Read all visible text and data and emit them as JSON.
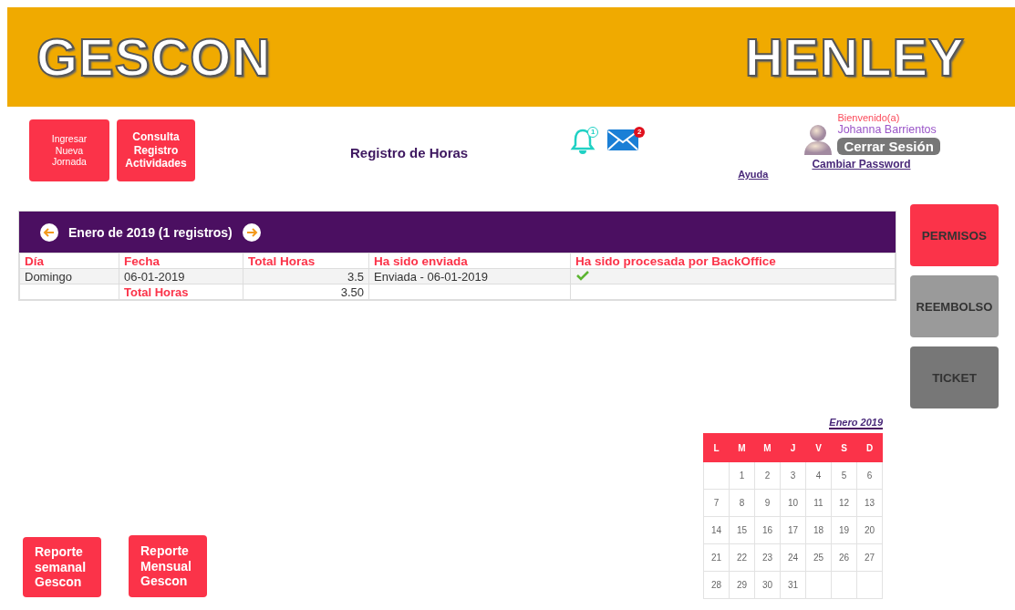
{
  "header": {
    "left_logo": "GESCON",
    "right_logo": "HENLEY"
  },
  "top_buttons": [
    "Ingresar\nNueva\nJornada",
    "Consulta\nRegistro\nActividades"
  ],
  "page_title": "Registro de Horas",
  "notifications": [
    {
      "kind": "bell",
      "count": "1"
    },
    {
      "kind": "mail",
      "count": "2"
    }
  ],
  "help_link": "Ayuda",
  "user": {
    "greeting": "Bienvenido(a)",
    "name": "Johanna Barrientos",
    "logout": "Cerrar Sesión",
    "change_password": "Cambiar Password"
  },
  "table": {
    "caption": "Enero de 2019 (1 registros)",
    "columns": [
      "Día",
      "Fecha",
      "Total Horas",
      "Ha sido enviada",
      "Ha sido procesada por BackOffice"
    ],
    "rows": [
      {
        "cells": [
          "Domingo",
          "06-01-2019",
          "3.5",
          "Enviada - 06-01-2019"
        ],
        "processed": true
      }
    ],
    "total": {
      "label": "Total Horas",
      "value": "3.50"
    }
  },
  "side_buttons": [
    {
      "label": "PERMISOS",
      "kind": "red"
    },
    {
      "label": "REEMBOLSO",
      "kind": "gray"
    },
    {
      "label": "TICKET",
      "kind": "dark"
    }
  ],
  "calendar": {
    "title": "Enero 2019",
    "weekdays": [
      "L",
      "M",
      "M",
      "J",
      "V",
      "S",
      "D"
    ],
    "weeks": [
      [
        "1",
        "2",
        "3",
        "4",
        "5",
        "6"
      ],
      [
        "7",
        "8",
        "9",
        "10",
        "11",
        "12",
        "13"
      ],
      [
        "14",
        "15",
        "16",
        "17",
        "18",
        "19",
        "20"
      ],
      [
        "21",
        "22",
        "23",
        "24",
        "25",
        "26",
        "27"
      ],
      [
        "28",
        "29",
        "30",
        "31"
      ]
    ]
  },
  "report_buttons": [
    "Reporte\nsemanal\nGescon",
    "Reporte\nMensual\nGescon"
  ]
}
